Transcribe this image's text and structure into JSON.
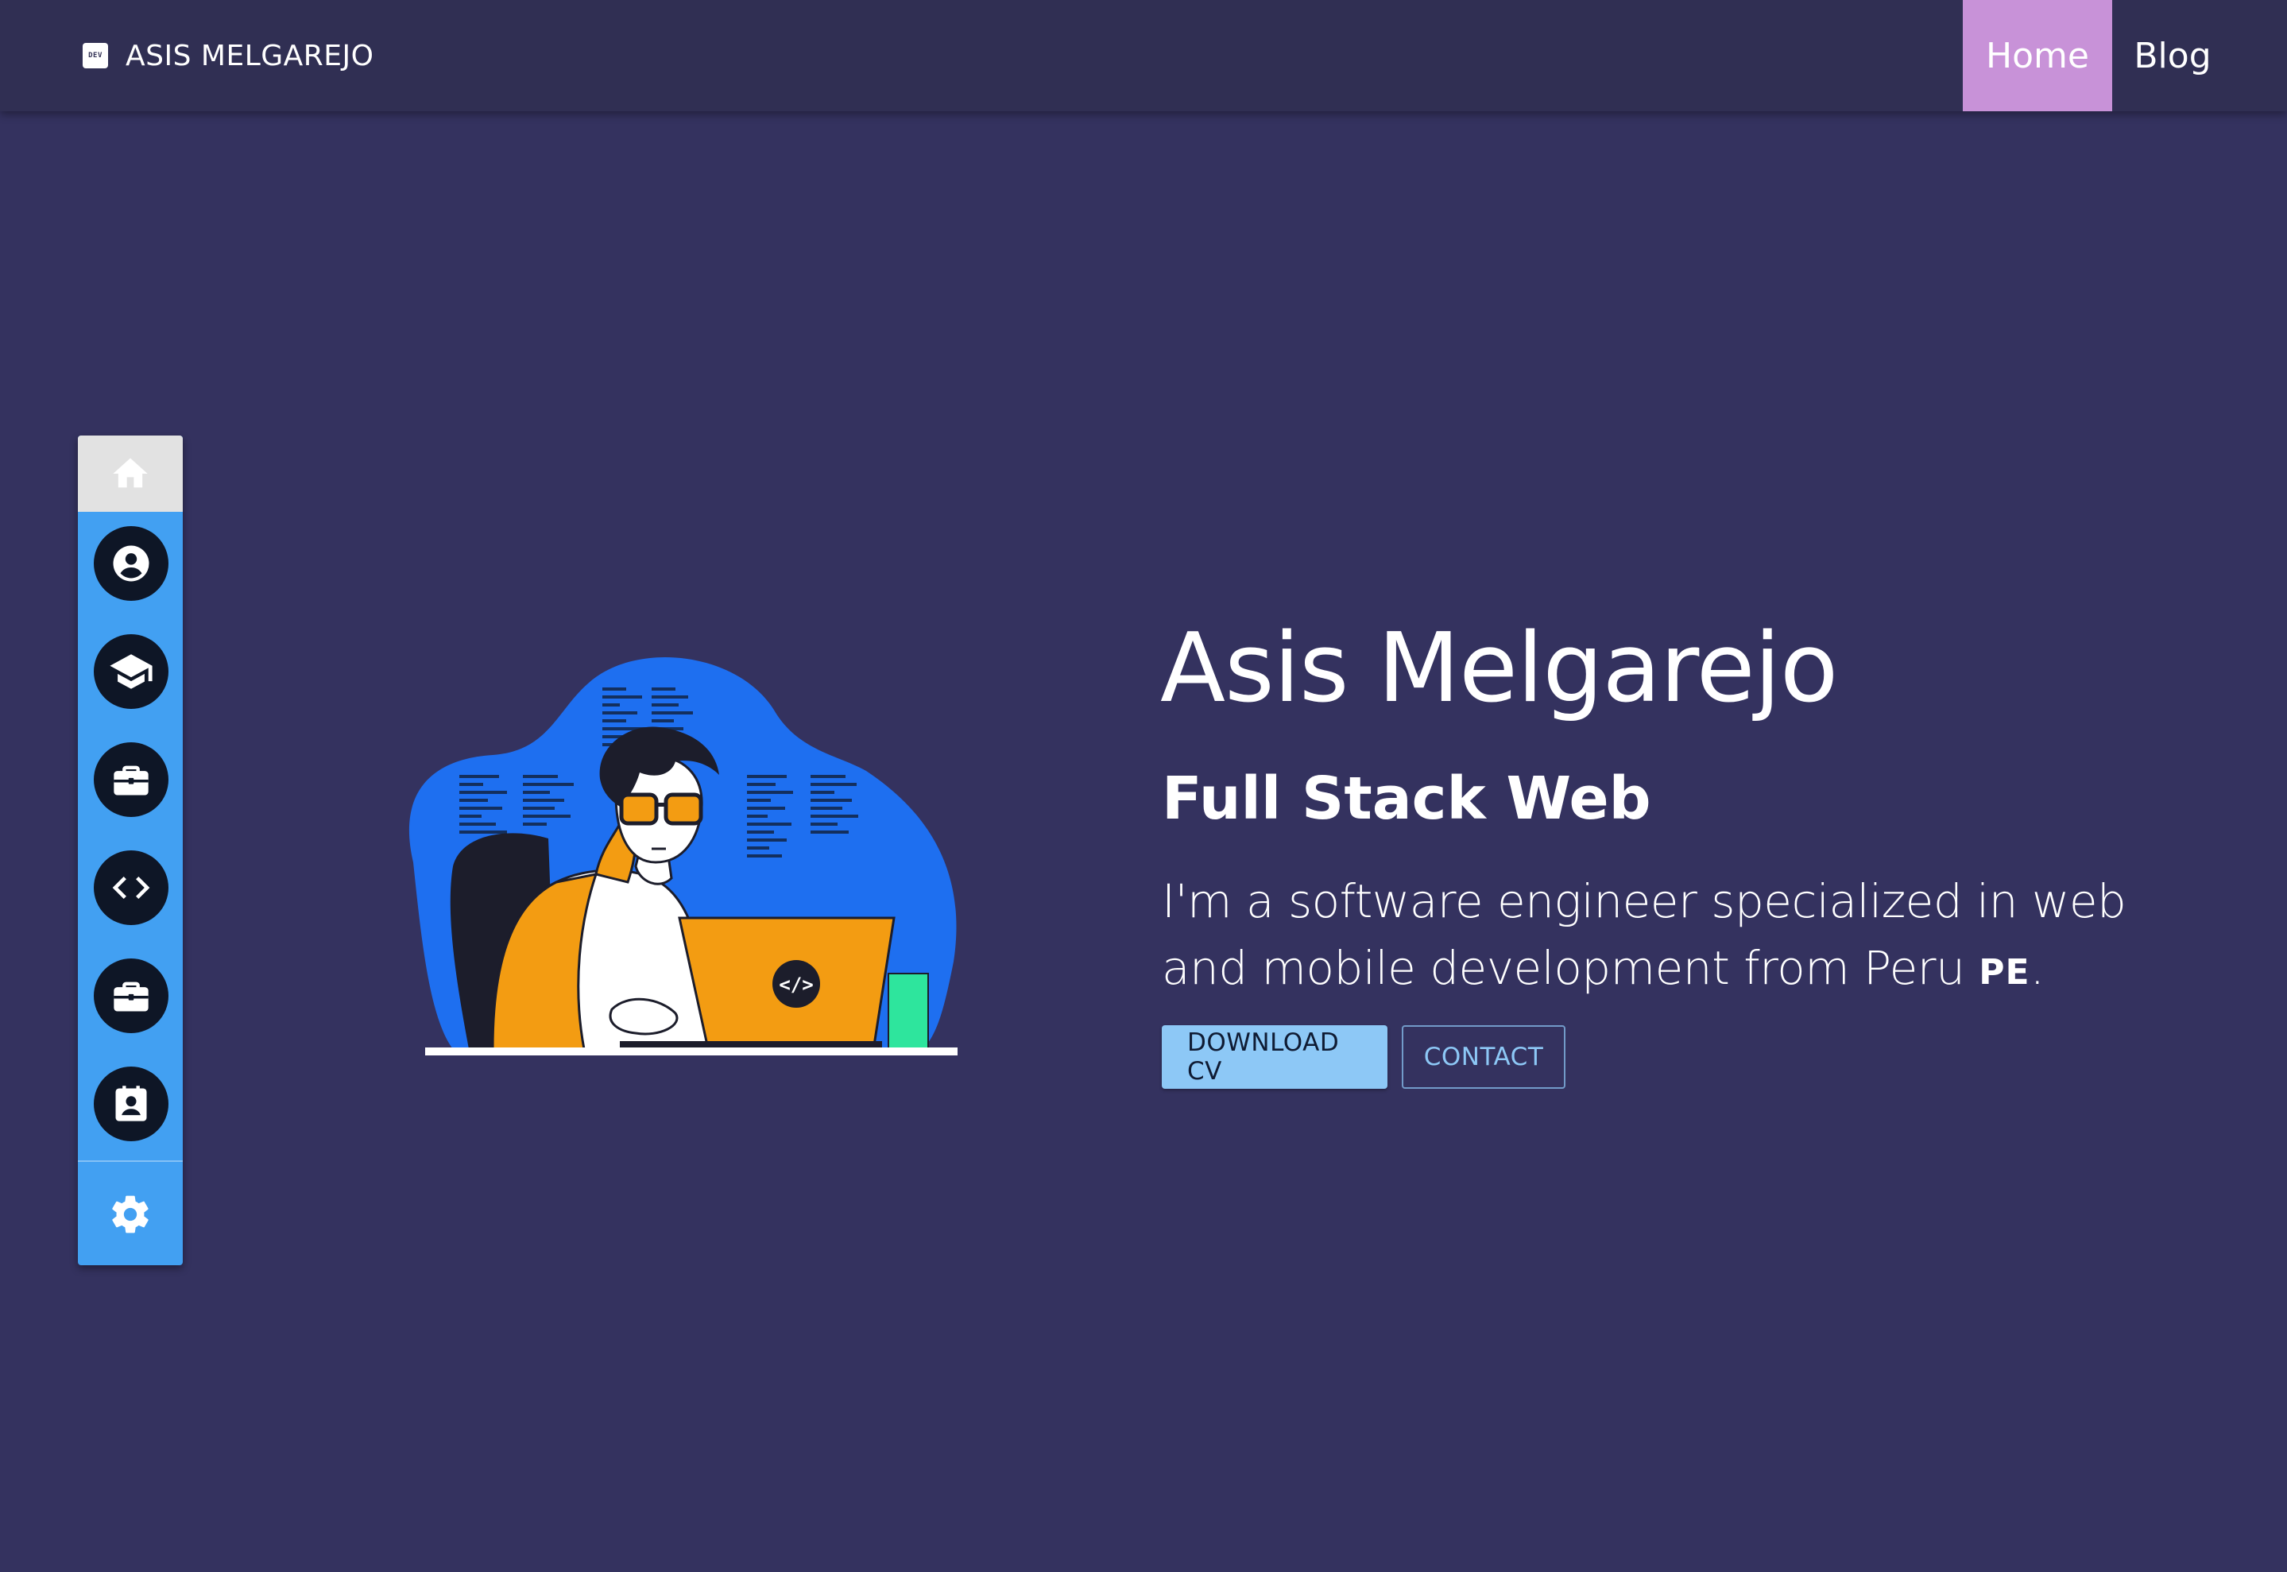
{
  "header": {
    "brand_badge": "DEV",
    "brand_title": "ASIS MELGAREJO",
    "nav": [
      {
        "label": "Home",
        "active": true
      },
      {
        "label": "Blog",
        "active": false
      }
    ]
  },
  "sidebar": {
    "items": [
      {
        "icon": "home-icon",
        "active": true
      },
      {
        "icon": "account-circle-icon"
      },
      {
        "icon": "graduation-cap-icon"
      },
      {
        "icon": "briefcase-icon"
      },
      {
        "icon": "code-icon"
      },
      {
        "icon": "briefcase-icon"
      },
      {
        "icon": "contact-badge-icon"
      },
      {
        "icon": "gear-icon"
      }
    ]
  },
  "hero": {
    "name": "Asis Melgarejo",
    "role": "Full Stack Web",
    "description": "I'm a software engineer specialized in web and mobile development from Peru",
    "country_code": "PE",
    "description_end": ".",
    "download_label": "DOWNLOAD CV",
    "contact_label": "CONTACT",
    "laptop_code_glyph": "</>"
  },
  "colors": {
    "background": "#34325f",
    "appbar": "#302f53",
    "nav_active": "#c892d8",
    "rail": "#42a0f2",
    "primary_button": "#8dc8f6"
  }
}
